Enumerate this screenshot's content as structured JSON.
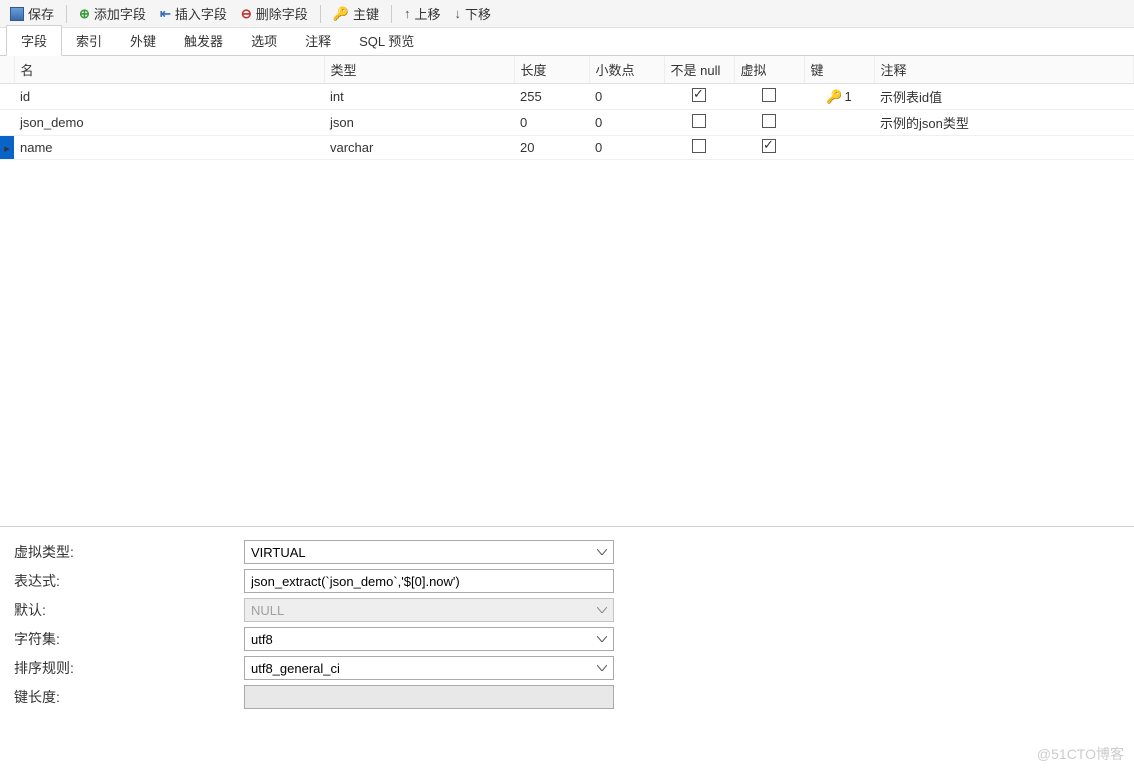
{
  "toolbar": {
    "save": "保存",
    "add_field": "添加字段",
    "insert_field": "插入字段",
    "delete_field": "删除字段",
    "primary_key": "主键",
    "move_up": "上移",
    "move_down": "下移"
  },
  "tabs": {
    "fields": "字段",
    "indexes": "索引",
    "fk": "外键",
    "triggers": "触发器",
    "options": "选项",
    "comment": "注释",
    "sql_preview": "SQL 预览"
  },
  "grid": {
    "headers": {
      "name": "名",
      "type": "类型",
      "length": "长度",
      "decimals": "小数点",
      "not_null": "不是 null",
      "virtual": "虚拟",
      "key": "键",
      "note": "注释"
    },
    "rows": [
      {
        "name": "id",
        "type": "int",
        "length": "255",
        "decimals": "0",
        "not_null": true,
        "virtual": false,
        "key_num": "1",
        "note": "示例表id值",
        "selected": false,
        "current": false
      },
      {
        "name": "json_demo",
        "type": "json",
        "length": "0",
        "decimals": "0",
        "not_null": false,
        "virtual": false,
        "key_num": "",
        "note": "示例的json类型",
        "selected": false,
        "current": false
      },
      {
        "name": "name",
        "type": "varchar",
        "length": "20",
        "decimals": "0",
        "not_null": false,
        "virtual": true,
        "key_num": "",
        "note": "",
        "selected": true,
        "current": true
      }
    ]
  },
  "props": {
    "virtual_type_label": "虚拟类型:",
    "virtual_type_value": "VIRTUAL",
    "expr_label": "表达式:",
    "expr_value": "json_extract(`json_demo`,'$[0].now')",
    "default_label": "默认:",
    "default_value": "NULL",
    "charset_label": "字符集:",
    "charset_value": "utf8",
    "collation_label": "排序规则:",
    "collation_value": "utf8_general_ci",
    "keylen_label": "键长度:",
    "keylen_value": ""
  },
  "watermark": "@51CTO博客"
}
